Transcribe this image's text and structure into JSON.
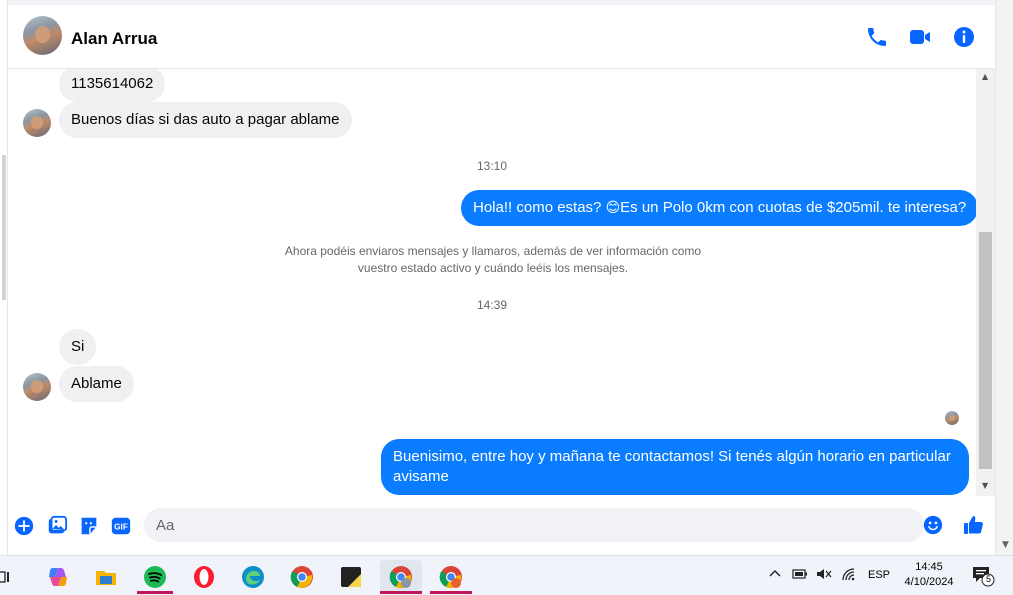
{
  "conversation": {
    "contact_name": "Alan Arrua"
  },
  "messages": {
    "in_1": "1135614062",
    "in_2": "Buenos días si das auto a pagar ablame",
    "time_1": "13:10",
    "out_1_text": "Hola!! como estas? ",
    "out_1_emoji": "😊",
    "out_1_rest": "Es un Polo 0km con cuotas de $205mil. te interesa?",
    "notice": "Ahora podéis enviaros mensajes y llamaros, además de ver información como vuestro estado activo y cuándo leéis los mensajes.",
    "time_2": "14:39",
    "in_3": "Si",
    "in_4": "Ablame",
    "out_2": "Buenisimo, entre hoy y mañana te contactamos! Si tenés algún horario en particular avisame"
  },
  "composer": {
    "placeholder": "Aa"
  },
  "taskbar": {
    "language": "ESP",
    "time": "14:45",
    "date": "4/10/2024",
    "notification_count": "5"
  },
  "colors": {
    "accent": "#0a7cff",
    "header_icon": "#0866ff",
    "incoming_bubble": "#f0f0f0"
  }
}
